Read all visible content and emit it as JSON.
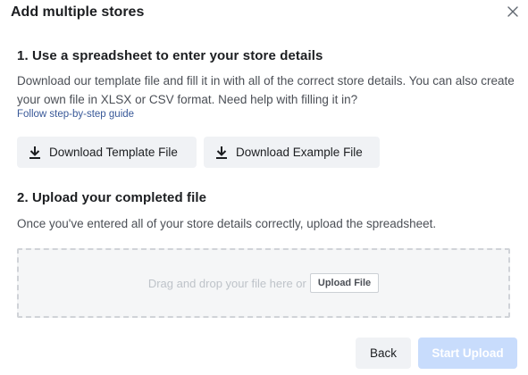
{
  "dialog": {
    "title": "Add multiple stores"
  },
  "section1": {
    "title": "1. Use a spreadsheet to enter your store details",
    "description": "Download our template file and fill it in with all of the correct store details. You can also create your own file in XLSX or CSV format. Need help with filling it in?",
    "guide_link": "Follow step-by-step guide",
    "download_template_label": "Download Template File",
    "download_example_label": "Download Example File"
  },
  "section2": {
    "title": "2. Upload your completed file",
    "description": "Once you've entered all of your store details correctly, upload the spreadsheet.",
    "dropzone_text": "Drag and drop your file here or",
    "upload_file_label": "Upload File"
  },
  "footer": {
    "back_label": "Back",
    "start_upload_label": "Start Upload",
    "start_upload_state": "disabled"
  },
  "colors": {
    "link": "#385898",
    "primary_disabled": "#c8dcfc",
    "secondary_button_bg": "#f0f2f5"
  },
  "icons": {
    "close": "close-icon",
    "download": "download-icon"
  }
}
